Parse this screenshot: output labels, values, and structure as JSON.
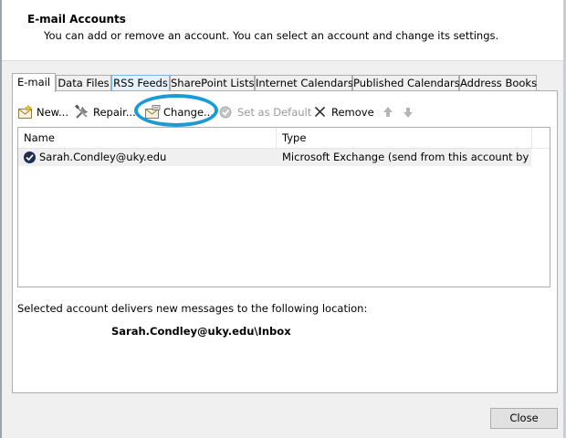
{
  "header": {
    "title": "E-mail Accounts",
    "description": "You can add or remove an account. You can select an account and change its settings."
  },
  "tabs": [
    {
      "label": "E-mail",
      "active": true
    },
    {
      "label": "Data Files"
    },
    {
      "label": "RSS Feeds"
    },
    {
      "label": "SharePoint Lists"
    },
    {
      "label": "Internet Calendars"
    },
    {
      "label": "Published Calendars"
    },
    {
      "label": "Address Books"
    }
  ],
  "toolbar": {
    "new_label": "New...",
    "repair_label": "Repair...",
    "change_label": "Change...",
    "set_default_label": "Set as Default",
    "remove_label": "Remove"
  },
  "list": {
    "columns": {
      "name": "Name",
      "type": "Type"
    },
    "rows": [
      {
        "name": "Sarah.Condley@uky.edu",
        "type": "Microsoft Exchange (send from this account by def..."
      }
    ]
  },
  "delivery": {
    "label": "Selected account delivers new messages to the following location:",
    "path": "Sarah.Condley@uky.edu\\Inbox"
  },
  "buttons": {
    "close_label": "Close"
  },
  "colors": {
    "highlight": "#1a9bd7",
    "selected_row": "#f0f0f0"
  },
  "icons": {
    "new": "new-account-envelope-icon",
    "repair": "repair-tools-icon",
    "change": "change-account-icon",
    "set_default": "check-circle-icon",
    "remove": "x-remove-icon",
    "move_up": "arrow-up-icon",
    "move_down": "arrow-down-icon",
    "default_account": "default-account-check-icon"
  }
}
